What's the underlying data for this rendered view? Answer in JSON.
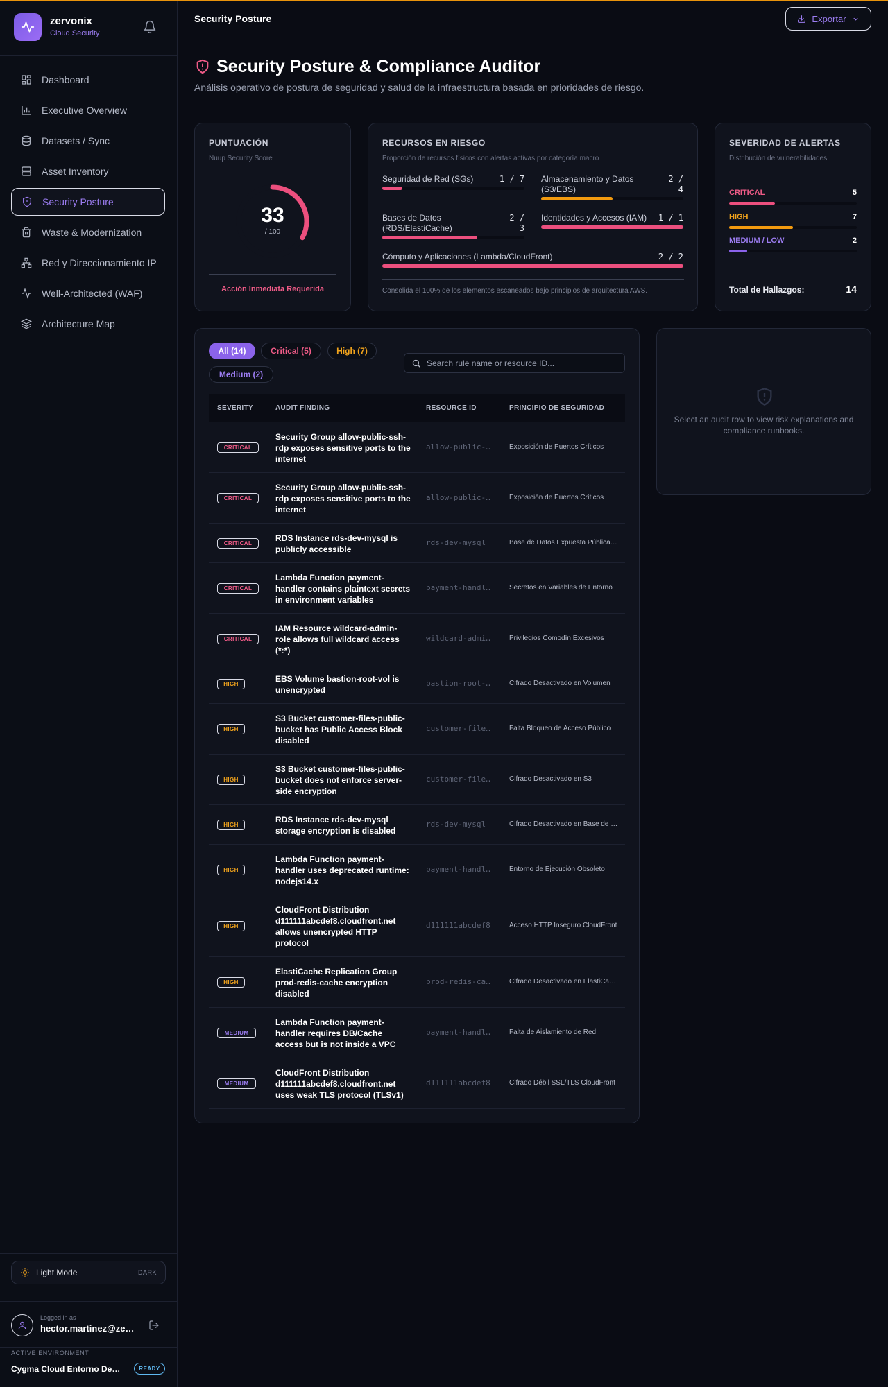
{
  "brand": {
    "name": "zervonix",
    "subtitle": "Cloud Security"
  },
  "nav": [
    {
      "label": "Dashboard",
      "icon": "grid-icon"
    },
    {
      "label": "Executive Overview",
      "icon": "bar-chart-icon"
    },
    {
      "label": "Datasets / Sync",
      "icon": "database-icon"
    },
    {
      "label": "Asset Inventory",
      "icon": "server-icon"
    },
    {
      "label": "Security Posture",
      "icon": "shield-icon",
      "active": true
    },
    {
      "label": "Waste & Modernization",
      "icon": "trash-icon"
    },
    {
      "label": "Red y Direccionamiento IP",
      "icon": "network-icon"
    },
    {
      "label": "Well-Architected (WAF)",
      "icon": "activity-icon"
    },
    {
      "label": "Architecture Map",
      "icon": "layers-icon"
    }
  ],
  "theme": {
    "label": "Light Mode",
    "alt": "DARK"
  },
  "user": {
    "label": "Logged in as",
    "email": "hector.martinez@zervonix.com"
  },
  "environment": {
    "label": "ACTIVE ENVIRONMENT",
    "name": "Cygma Cloud Entorno Desarrollo",
    "status": "READY"
  },
  "header": {
    "title": "Security Posture",
    "export_label": "Exportar"
  },
  "page": {
    "title": "Security Posture & Compliance Auditor",
    "subtitle": "Análisis operativo de postura de seguridad y salud de la infraestructura basada en prioridades de riesgo."
  },
  "score": {
    "title": "PUNTUACIÓN",
    "subtitle": "Nuup Security Score",
    "value": "33",
    "max": "/ 100",
    "fraction": 0.33,
    "action": "Acción Inmediata Requerida"
  },
  "resources": {
    "title": "RECURSOS EN RIESGO",
    "subtitle": "Proporción de recursos físicos con alertas activas por categoría macro",
    "items": [
      {
        "label": "Seguridad de Red (SGs)",
        "count": "1 / 7",
        "fraction": 0.143,
        "color": "#ec4f7e"
      },
      {
        "label": "Almacenamiento y Datos (S3/EBS)",
        "count": "2 / 4",
        "fraction": 0.5,
        "color": "#f29a0f"
      },
      {
        "label": "Bases de Datos (RDS/ElastiCache)",
        "count": "2 / 3",
        "fraction": 0.667,
        "color": "#ec4f7e"
      },
      {
        "label": "Identidades y Accesos (IAM)",
        "count": "1 / 1",
        "fraction": 1.0,
        "color": "#ec4f7e"
      },
      {
        "label": "Cómputo y Aplicaciones (Lambda/CloudFront)",
        "count": "2 / 2",
        "fraction": 1.0,
        "color": "#ec4f7e"
      }
    ],
    "footer": "Consolida el 100% de los elementos escaneados bajo principios de arquitectura AWS."
  },
  "severity": {
    "title": "SEVERIDAD DE ALERTAS",
    "subtitle": "Distribución de vulnerabilidades",
    "rows": [
      {
        "label": "CRITICAL",
        "count": "5",
        "fraction": 0.357,
        "color": "#ec4f7e"
      },
      {
        "label": "HIGH",
        "count": "7",
        "fraction": 0.5,
        "color": "#f29a0f"
      },
      {
        "label": "MEDIUM / LOW",
        "count": "2",
        "fraction": 0.143,
        "color": "#8b63ea"
      }
    ],
    "total_label": "Total de Hallazgos:",
    "total": "14"
  },
  "filters": [
    {
      "label": "All (14)",
      "active": true,
      "color": "#ffffff"
    },
    {
      "label": "Critical (5)",
      "color": "#ef5b87"
    },
    {
      "label": "High (7)",
      "color": "#f1a31c"
    },
    {
      "label": "Medium (2)",
      "color": "#9b7cf0"
    }
  ],
  "search": {
    "placeholder": "Search rule name or resource ID..."
  },
  "table": {
    "headers": [
      "SEVERITY",
      "AUDIT FINDING",
      "RESOURCE ID",
      "PRINCIPIO DE SEGURIDAD"
    ],
    "rows": [
      {
        "severity": "CRITICAL",
        "finding": "Security Group allow-public-ssh-rdp exposes sensitive ports to the internet",
        "resource": "allow-public-ssh-rdp",
        "principle": "Exposición de Puertos Críticos"
      },
      {
        "severity": "CRITICAL",
        "finding": "Security Group allow-public-ssh-rdp exposes sensitive ports to the internet",
        "resource": "allow-public-ssh-rdp",
        "principle": "Exposición de Puertos Críticos"
      },
      {
        "severity": "CRITICAL",
        "finding": "RDS Instance rds-dev-mysql is publicly accessible",
        "resource": "rds-dev-mysql",
        "principle": "Base de Datos Expuesta Públicamente"
      },
      {
        "severity": "CRITICAL",
        "finding": "Lambda Function payment-handler contains plaintext secrets in environment variables",
        "resource": "payment-handler",
        "principle": "Secretos en Variables de Entorno"
      },
      {
        "severity": "CRITICAL",
        "finding": "IAM Resource wildcard-admin-role allows full wildcard access (*:*)",
        "resource": "wildcard-admin-role",
        "principle": "Privilegios Comodín Excesivos"
      },
      {
        "severity": "HIGH",
        "finding": "EBS Volume bastion-root-vol is unencrypted",
        "resource": "bastion-root-vol",
        "principle": "Cifrado Desactivado en Volumen"
      },
      {
        "severity": "HIGH",
        "finding": "S3 Bucket customer-files-public-bucket has Public Access Block disabled",
        "resource": "customer-files-public-bucket",
        "principle": "Falta Bloqueo de Acceso Público"
      },
      {
        "severity": "HIGH",
        "finding": "S3 Bucket customer-files-public-bucket does not enforce server-side encryption",
        "resource": "customer-files-public-bucket",
        "principle": "Cifrado Desactivado en S3"
      },
      {
        "severity": "HIGH",
        "finding": "RDS Instance rds-dev-mysql storage encryption is disabled",
        "resource": "rds-dev-mysql",
        "principle": "Cifrado Desactivado en Base de Datos"
      },
      {
        "severity": "HIGH",
        "finding": "Lambda Function payment-handler uses deprecated runtime: nodejs14.x",
        "resource": "payment-handler",
        "principle": "Entorno de Ejecución Obsoleto"
      },
      {
        "severity": "HIGH",
        "finding": "CloudFront Distribution d111111abcdef8.cloudfront.net allows unencrypted HTTP protocol",
        "resource": "d111111abcdef8",
        "principle": "Acceso HTTP Inseguro CloudFront"
      },
      {
        "severity": "HIGH",
        "finding": "ElastiCache Replication Group prod-redis-cache encryption disabled",
        "resource": "prod-redis-cache",
        "principle": "Cifrado Desactivado en ElastiCache"
      },
      {
        "severity": "MEDIUM",
        "finding": "Lambda Function payment-handler requires DB/Cache access but is not inside a VPC",
        "resource": "payment-handler",
        "principle": "Falta de Aislamiento de Red"
      },
      {
        "severity": "MEDIUM",
        "finding": "CloudFront Distribution d111111abcdef8.cloudfront.net uses weak TLS protocol (TLSv1)",
        "resource": "d111111abcdef8",
        "principle": "Cifrado Débil SSL/TLS CloudFront"
      }
    ]
  },
  "detail": {
    "empty_text": "Select an audit row to view risk explanations and compliance runbooks."
  }
}
